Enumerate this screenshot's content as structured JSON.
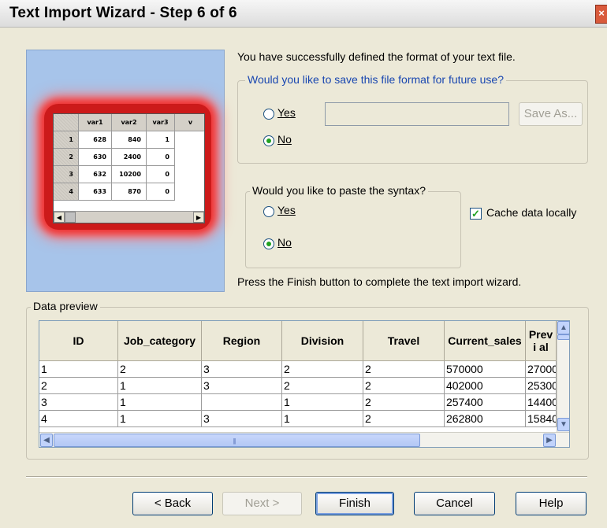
{
  "window": {
    "title": "Text Import Wizard - Step 6 of 6",
    "close_glyph": "×"
  },
  "illustration": {
    "columns": [
      "var1",
      "var2",
      "var3",
      "v"
    ],
    "rows": [
      {
        "num": "1",
        "cells": [
          "628",
          "840",
          "1"
        ]
      },
      {
        "num": "2",
        "cells": [
          "630",
          "2400",
          "0"
        ]
      },
      {
        "num": "3",
        "cells": [
          "632",
          "10200",
          "0"
        ]
      },
      {
        "num": "4",
        "cells": [
          "633",
          "870",
          "0"
        ]
      }
    ]
  },
  "intro_text": "You have successfully defined the format of your text file.",
  "save_format": {
    "legend": "Would you like to save this file format for future use?",
    "yes_label": "Yes",
    "no_label": "No",
    "selected": "No",
    "filename_value": "",
    "save_as_label": "Save As..."
  },
  "paste_syntax": {
    "legend": "Would you like to paste the syntax?",
    "yes_label": "Yes",
    "no_label": "No",
    "selected": "No"
  },
  "cache_data": {
    "label": "Cache data locally",
    "checked": true
  },
  "finish_text": "Press the Finish button to complete the text import wizard.",
  "data_preview": {
    "legend": "Data preview",
    "columns": [
      "ID",
      "Job_category",
      "Region",
      "Division",
      "Travel",
      "Current_sales",
      "Previ al"
    ],
    "rows": [
      [
        "1",
        "2",
        "3",
        "2",
        "2",
        "570000",
        "27000"
      ],
      [
        "2",
        "1",
        "3",
        "2",
        "2",
        "402000",
        "25300"
      ],
      [
        "3",
        "1",
        "",
        "1",
        "2",
        "257400",
        "14400"
      ],
      [
        "4",
        "1",
        "3",
        "1",
        "2",
        "262800",
        "15840"
      ]
    ]
  },
  "buttons": {
    "back": "< Back",
    "next": "Next >",
    "finish": "Finish",
    "cancel": "Cancel",
    "help": "Help"
  },
  "icons": {
    "scroll_up": "▲",
    "scroll_down": "▼",
    "scroll_left": "◀",
    "scroll_right": "▶",
    "check": "✓"
  }
}
